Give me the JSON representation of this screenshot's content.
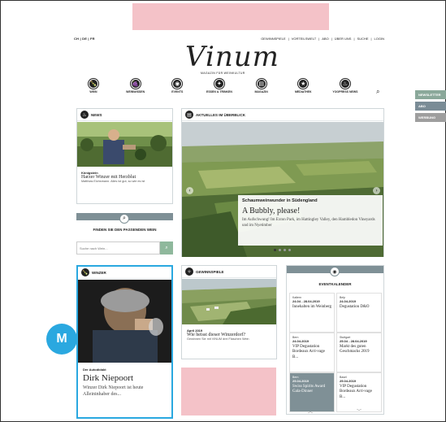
{
  "header": {
    "languages": "CH | DE | FR",
    "top_links": [
      "GEWINNSPIELE",
      "VORTEILSWELT",
      "ABO",
      "ÜBER UNS",
      "SUCHE",
      "LOGIN"
    ],
    "logo": "Vinum",
    "tagline": "MAGAZIN FÜR WEINKULTUR"
  },
  "nav": [
    {
      "label": "WEIN",
      "icon": "wine-bottle-icon",
      "glyph": "🍾"
    },
    {
      "label": "WEINWISSEN",
      "icon": "grapes-icon",
      "glyph": "🍇"
    },
    {
      "label": "EVENTS",
      "icon": "location-pin-icon",
      "glyph": "◉"
    },
    {
      "label": "ESSEN & TRINKEN",
      "icon": "plate-icon",
      "glyph": "✦"
    },
    {
      "label": "MAGAZIN",
      "icon": "magazine-icon",
      "glyph": "▤"
    },
    {
      "label": "MEDIATHEK",
      "icon": "star-icon",
      "glyph": "★"
    },
    {
      "label": "YOOPRESS NEWS",
      "icon": "fire-icon",
      "glyph": "♨"
    }
  ],
  "side_tabs": [
    "NEWSLETTER",
    "ABO",
    "WERBUNG"
  ],
  "news": {
    "title": "NEWS",
    "kicker": "Königstein",
    "headline": "Harzer Winzer mit Herzblut",
    "teaser": "Matthias Eichsmann. Alles ist gut, so wie es ist"
  },
  "search": {
    "title": "FINDEN SIE DEN PASSENDEN WEIN",
    "placeholder": "Suche nach Wein..."
  },
  "highlight": {
    "title": "AKTUELLES IM ÜBERBLICK",
    "kicker": "Schaumweinwunder in Südengland",
    "headline": "A Bubbly, please!",
    "teaser": "Im Aufschwung! Im Exton Park, im Hattingley Valley, den Hambledon Vineyards und im Nyetimber"
  },
  "winzer": {
    "title": "WINZER",
    "kicker": "Der Autodidakt",
    "headline": "Dirk Niepoort",
    "teaser": "Winzer Dirk Niepoort ist heute Alleininhaber des..."
  },
  "gewinnspiele": {
    "title": "GEWINNSPIELE",
    "kicker": "April 2019",
    "headline": "Wie heisst dieser Winzerdorf?",
    "teaser": "Gewinnen Sie mit VINUM drei Flaschen Wein"
  },
  "eventkalender": {
    "title": "EVENTKALENDER",
    "events": [
      {
        "place": "Kaltern",
        "date": "24.04 - 28.04.2019",
        "title": "Innehalten im Weinberg"
      },
      {
        "place": "Belp",
        "date": "24.04.2019",
        "title": "Degustation D&O"
      },
      {
        "place": "Bern",
        "date": "24.04.2019",
        "title": "VIP Degustation Bordeaux Arri-vage B..."
      },
      {
        "place": "Stuttgart",
        "date": "25.04 - 28.04.2019",
        "title": "Markt des guten Geschmacks 2019"
      },
      {
        "place": "Bern",
        "date": "25.04.2019",
        "title": "Swiss Spirits Award Gala-Dinner"
      },
      {
        "place": "Basel",
        "date": "25.04.2019",
        "title": "VIP Degustation Bordeaux Arri-vage B..."
      }
    ]
  },
  "badge": "M"
}
